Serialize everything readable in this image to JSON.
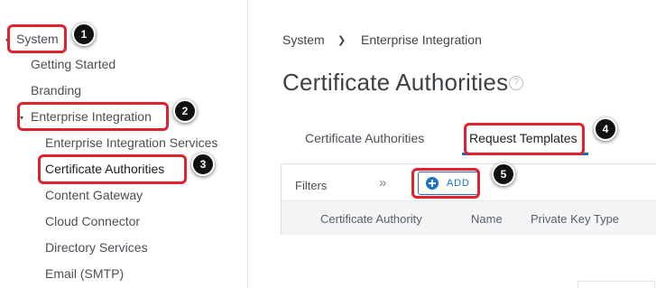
{
  "sidebar": {
    "items": [
      {
        "label": "System"
      },
      {
        "label": "Getting Started"
      },
      {
        "label": "Branding"
      },
      {
        "label": "Enterprise Integration"
      },
      {
        "label": "Enterprise Integration Services"
      },
      {
        "label": "Certificate Authorities"
      },
      {
        "label": "Content Gateway"
      },
      {
        "label": "Cloud Connector"
      },
      {
        "label": "Directory Services"
      },
      {
        "label": "Email (SMTP)"
      }
    ]
  },
  "breadcrumb": {
    "root": "System",
    "separator": "❯",
    "current": "Enterprise Integration"
  },
  "page": {
    "title": "Certificate Authorities",
    "help": "?"
  },
  "tabs": [
    {
      "label": "Certificate Authorities"
    },
    {
      "label": "Request Templates"
    }
  ],
  "toolbar": {
    "filters_label": "Filters",
    "expand_glyph": "»",
    "add_label": "ADD"
  },
  "table": {
    "columns": [
      "Certificate Authority",
      "Name",
      "Private Key Type"
    ]
  },
  "callouts": [
    "1",
    "2",
    "3",
    "4",
    "5"
  ],
  "colors": {
    "accent": "#1a73c9",
    "highlight": "#e0212e",
    "badge": "#111111"
  }
}
